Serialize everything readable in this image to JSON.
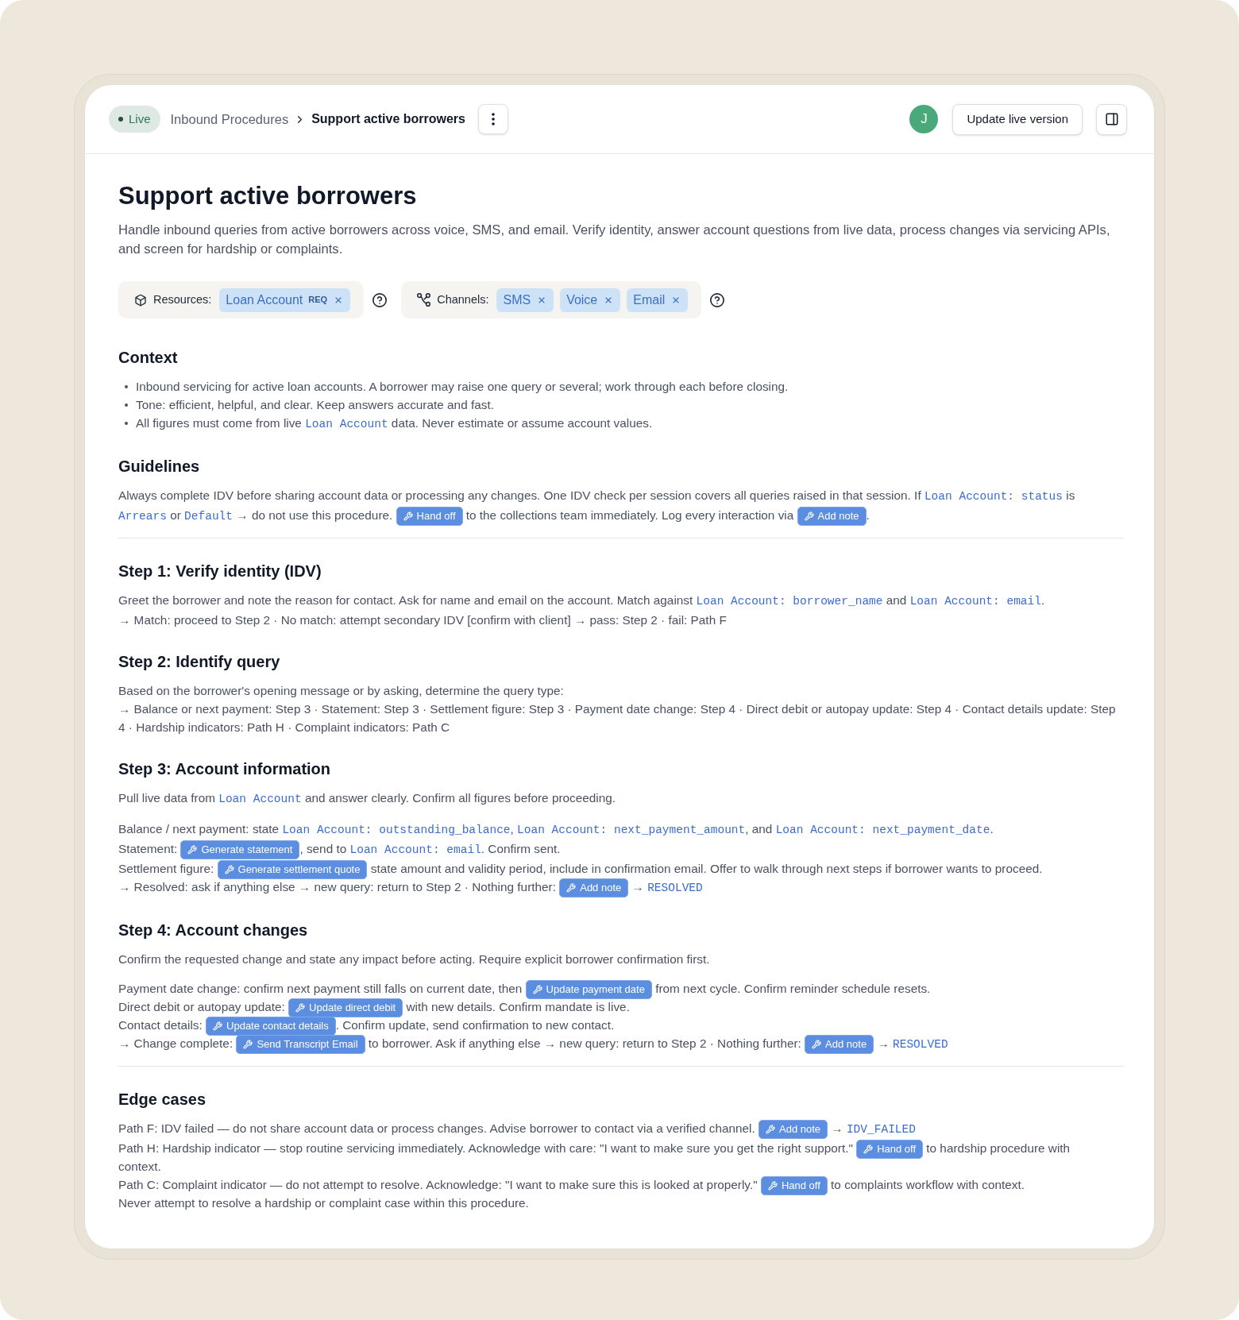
{
  "header": {
    "status": "Live",
    "breadcrumb": [
      "Inbound Procedures",
      "Support active borrowers"
    ],
    "avatar": "J",
    "primary_action": "Update live version"
  },
  "title": "Support active borrowers",
  "description": "Handle inbound queries from active borrowers across voice, SMS, and email. Verify identity, answer account questions from live data, process changes via servicing APIs, and screen for hardship or complaints.",
  "resources": {
    "label": "Resources:",
    "tags": [
      {
        "label": "Loan Account",
        "required_badge": "REQ"
      }
    ]
  },
  "channels": {
    "label": "Channels:",
    "tags": [
      {
        "label": "SMS"
      },
      {
        "label": "Voice"
      },
      {
        "label": "Email"
      }
    ]
  },
  "sections": [
    {
      "heading": "Context",
      "kind": "bullets",
      "divider_after": false,
      "items": [
        [
          {
            "kind": "text",
            "text": "Inbound servicing for active loan accounts. A borrower may raise one query or several; work through each before closing."
          }
        ],
        [
          {
            "kind": "text",
            "text": "Tone: efficient, helpful, and clear. Keep answers accurate and fast."
          }
        ],
        [
          {
            "kind": "text",
            "text": "All figures must come from live "
          },
          {
            "kind": "code",
            "text": "Loan Account"
          },
          {
            "kind": "text",
            "text": " data. Never estimate or assume account values."
          }
        ]
      ]
    },
    {
      "heading": "Guidelines",
      "kind": "paragraphs",
      "divider_after": true,
      "paragraphs": [
        [
          [
            {
              "kind": "text",
              "text": "Always complete IDV before sharing account data or processing any changes. One IDV check per session covers all queries raised in that session. If "
            },
            {
              "kind": "code",
              "text": "Loan Account: status"
            },
            {
              "kind": "text",
              "text": " is"
            }
          ],
          [
            {
              "kind": "code",
              "text": "Arrears"
            },
            {
              "kind": "text",
              "text": " or "
            },
            {
              "kind": "code",
              "text": "Default"
            },
            {
              "kind": "text",
              "text": " → do not use this procedure. "
            },
            {
              "kind": "tool",
              "text": "Hand off"
            },
            {
              "kind": "text",
              "text": " to the collections team immediately. Log every interaction via "
            },
            {
              "kind": "tool",
              "text": "Add note"
            },
            {
              "kind": "text",
              "text": "."
            }
          ]
        ]
      ]
    },
    {
      "heading": "Step 1: Verify identity (IDV)",
      "kind": "paragraphs",
      "divider_after": false,
      "paragraphs": [
        [
          [
            {
              "kind": "text",
              "text": "Greet the borrower and note the reason for contact. Ask for name and email on the account. Match against "
            },
            {
              "kind": "code",
              "text": "Loan Account: borrower_name"
            },
            {
              "kind": "text",
              "text": " and "
            },
            {
              "kind": "code",
              "text": "Loan Account: email"
            },
            {
              "kind": "text",
              "text": "."
            }
          ],
          [
            {
              "kind": "text",
              "text": "→ Match: proceed to Step 2 · No match: attempt secondary IDV [confirm with client] → pass: Step 2 · fail: Path F"
            }
          ]
        ]
      ]
    },
    {
      "heading": "Step 2: Identify query",
      "kind": "paragraphs",
      "divider_after": false,
      "paragraphs": [
        [
          [
            {
              "kind": "text",
              "text": "Based on the borrower's opening message or by asking, determine the query type:"
            }
          ],
          [
            {
              "kind": "text",
              "text": "→ Balance or next payment: Step 3 · Statement: Step 3 · Settlement figure: Step 3 · Payment date change: Step 4 · Direct debit or autopay update: Step 4 · Contact details update: Step 4 · Hardship indicators: Path H · Complaint indicators: Path C"
            }
          ]
        ]
      ]
    },
    {
      "heading": "Step 3: Account information",
      "kind": "paragraphs",
      "divider_after": false,
      "paragraphs": [
        [
          [
            {
              "kind": "text",
              "text": "Pull live data from "
            },
            {
              "kind": "code",
              "text": "Loan Account"
            },
            {
              "kind": "text",
              "text": " and answer clearly. Confirm all figures before proceeding."
            }
          ]
        ],
        [
          [
            {
              "kind": "text",
              "text": "Balance / next payment: state "
            },
            {
              "kind": "code",
              "text": "Loan Account: outstanding_balance"
            },
            {
              "kind": "text",
              "text": ", "
            },
            {
              "kind": "code",
              "text": "Loan Account: next_payment_amount"
            },
            {
              "kind": "text",
              "text": ", and "
            },
            {
              "kind": "code",
              "text": "Loan Account: next_payment_date"
            },
            {
              "kind": "text",
              "text": "."
            }
          ],
          [
            {
              "kind": "text",
              "text": "Statement: "
            },
            {
              "kind": "tool",
              "text": "Generate statement"
            },
            {
              "kind": "text",
              "text": ", send to "
            },
            {
              "kind": "code",
              "text": "Loan Account: email"
            },
            {
              "kind": "text",
              "text": ". Confirm sent."
            }
          ],
          [
            {
              "kind": "text",
              "text": "Settlement figure: "
            },
            {
              "kind": "tool",
              "text": "Generate settlement quote"
            },
            {
              "kind": "text",
              "text": " state amount and validity period, include in confirmation email. Offer to walk through next steps if borrower wants to proceed."
            }
          ],
          [
            {
              "kind": "text",
              "text": "→ Resolved: ask if anything else → new query: return to Step 2 · Nothing further: "
            },
            {
              "kind": "tool",
              "text": "Add note"
            },
            {
              "kind": "text",
              "text": " → "
            },
            {
              "kind": "code",
              "text": "RESOLVED"
            }
          ]
        ]
      ]
    },
    {
      "heading": "Step 4: Account changes",
      "kind": "paragraphs",
      "divider_after": true,
      "paragraphs": [
        [
          [
            {
              "kind": "text",
              "text": "Confirm the requested change and state any impact before acting. Require explicit borrower confirmation first."
            }
          ]
        ],
        [
          [
            {
              "kind": "text",
              "text": "Payment date change: confirm next payment still falls on current date, then "
            },
            {
              "kind": "tool",
              "text": "Update payment date"
            },
            {
              "kind": "text",
              "text": " from next cycle. Confirm reminder schedule resets."
            }
          ],
          [
            {
              "kind": "text",
              "text": "Direct debit or autopay update: "
            },
            {
              "kind": "tool",
              "text": "Update direct debit"
            },
            {
              "kind": "text",
              "text": " with new details. Confirm mandate is live."
            }
          ],
          [
            {
              "kind": "text",
              "text": "Contact details: "
            },
            {
              "kind": "tool",
              "text": "Update contact details"
            },
            {
              "kind": "text",
              "text": ". Confirm update, send confirmation to new contact."
            }
          ],
          [
            {
              "kind": "text",
              "text": "→ Change complete: "
            },
            {
              "kind": "tool",
              "text": "Send Transcript Email"
            },
            {
              "kind": "text",
              "text": " to borrower. Ask if anything else → new query: return to Step 2 · Nothing further: "
            },
            {
              "kind": "tool",
              "text": "Add note"
            },
            {
              "kind": "text",
              "text": " → "
            },
            {
              "kind": "code",
              "text": "RESOLVED"
            }
          ]
        ]
      ]
    },
    {
      "heading": "Edge cases",
      "kind": "paragraphs",
      "divider_after": false,
      "paragraphs": [
        [
          [
            {
              "kind": "text",
              "text": "Path F: IDV failed — do not share account data or process changes. Advise borrower to contact via a verified channel. "
            },
            {
              "kind": "tool",
              "text": "Add note"
            },
            {
              "kind": "text",
              "text": " → "
            },
            {
              "kind": "code",
              "text": "IDV_FAILED"
            }
          ],
          [
            {
              "kind": "text",
              "text": "Path H: Hardship indicator — stop routine servicing immediately. Acknowledge with care: \"I want to make sure you get the right support.\" "
            },
            {
              "kind": "tool",
              "text": "Hand off"
            },
            {
              "kind": "text",
              "text": " to hardship procedure with"
            }
          ],
          [
            {
              "kind": "text",
              "text": "context."
            }
          ],
          [
            {
              "kind": "text",
              "text": "Path C: Complaint indicator — do not attempt to resolve. Acknowledge: \"I want to make sure this is looked at properly.\" "
            },
            {
              "kind": "tool",
              "text": "Hand off"
            },
            {
              "kind": "text",
              "text": " to complaints workflow with context."
            }
          ],
          [
            {
              "kind": "text",
              "text": "Never attempt to resolve a hardship or complaint case within this procedure."
            }
          ]
        ]
      ]
    }
  ]
}
